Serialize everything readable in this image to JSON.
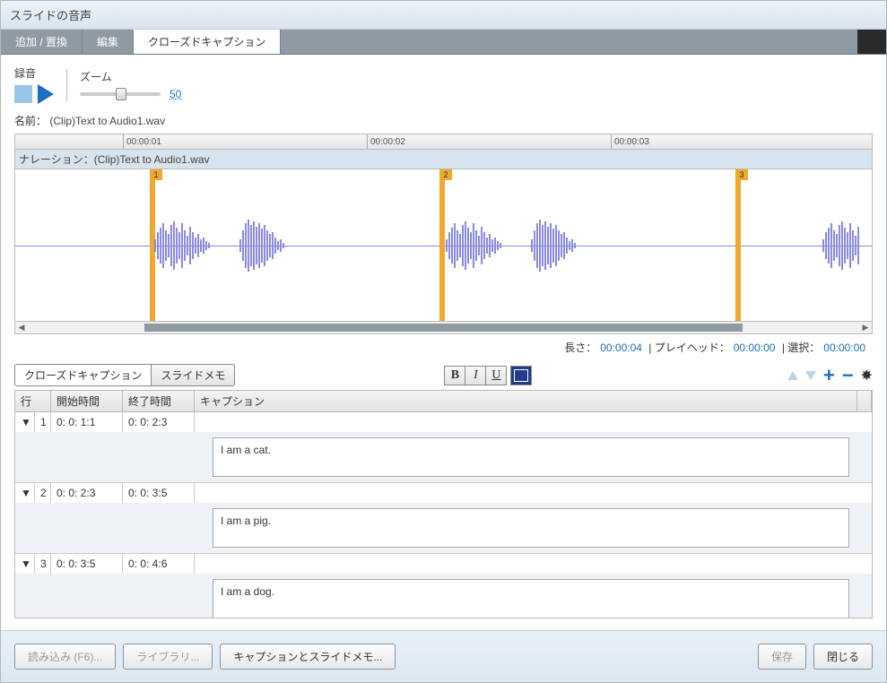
{
  "window": {
    "title": "スライドの音声"
  },
  "tabs": [
    {
      "label": "追加 / 置換"
    },
    {
      "label": "編集"
    },
    {
      "label": "クローズドキャプション",
      "active": true
    }
  ],
  "recording": {
    "label": "録音"
  },
  "zoom": {
    "label": "ズーム",
    "value": "50"
  },
  "name": {
    "label": "名前：",
    "value": "(Clip)Text to Audio1.wav"
  },
  "ruler": {
    "t1": "00:00:01",
    "t2": "00:00:02",
    "t3": "00:00:03"
  },
  "narration": {
    "label": "ナレーション：",
    "value": "(Clip)Text to Audio1.wav"
  },
  "markers": {
    "m1": "1",
    "m2": "2",
    "m3": "3"
  },
  "status": {
    "length_label": "長さ：",
    "length_val": "00:00:04",
    "playhead_label": "プレイヘッド：",
    "playhead_val": "00:00:00",
    "selection_label": "選択：",
    "selection_val": "00:00:00",
    "sep": " | "
  },
  "subtabs": {
    "cc": "クローズドキャプション",
    "memo": "スライドメモ"
  },
  "format": {
    "bold": "B",
    "italic": "I",
    "underline": "U"
  },
  "grid": {
    "headers": {
      "row": "行",
      "start": "開始時間",
      "end": "終了時間",
      "caption": "キャプション"
    },
    "rows": [
      {
        "num": "1",
        "start": "0: 0: 1:1",
        "end": "0: 0: 2:3",
        "text": "I am a cat."
      },
      {
        "num": "2",
        "start": "0: 0: 2:3",
        "end": "0: 0: 3:5",
        "text": "I am a pig."
      },
      {
        "num": "3",
        "start": "0: 0: 3:5",
        "end": "0: 0: 4:6",
        "text": "I am a dog."
      }
    ]
  },
  "footer": {
    "import": "読み込み (F6)...",
    "library": "ライブラリ...",
    "caption_memo": "キャプションとスライドメモ...",
    "save": "保存",
    "close": "閉じる"
  }
}
